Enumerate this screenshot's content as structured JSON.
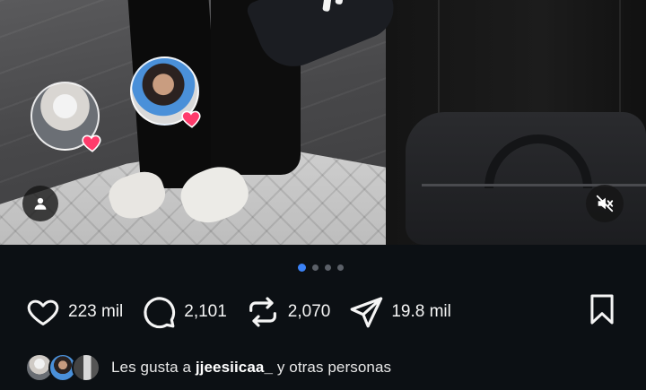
{
  "post": {
    "carousel": {
      "total_slides": 4,
      "active_index": 0
    },
    "actions": {
      "like_count": "223 mil",
      "comment_count": "2,101",
      "repost_count": "2,070",
      "share_count": "19.8 mil"
    },
    "likes": {
      "prefix": "Les gusta a ",
      "username": "jjeesiicaa_",
      "suffix": " y otras personas"
    }
  },
  "colors": {
    "background": "#0c1014",
    "active_dot": "#3b82f6",
    "heart_badge": "#ff3b6b"
  },
  "icons": [
    "heart-icon",
    "comment-icon",
    "repost-icon",
    "share-icon",
    "bookmark-icon",
    "person-icon",
    "muted-speaker-icon"
  ]
}
